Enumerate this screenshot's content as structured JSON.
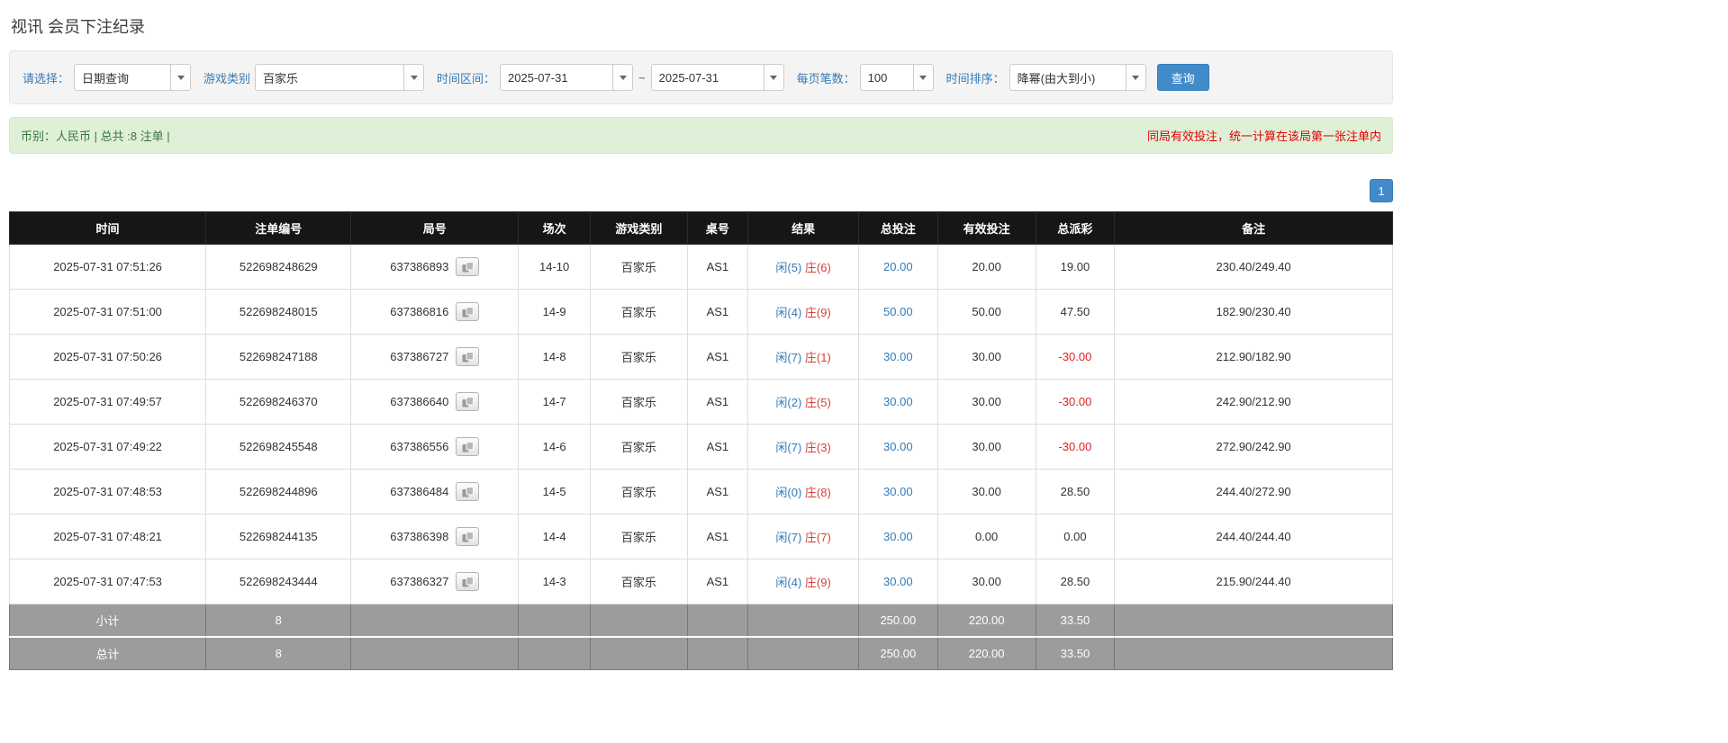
{
  "page": {
    "title": "视讯 会员下注纪录"
  },
  "filters": {
    "select_label": "请选择：",
    "select_value": "日期查询",
    "game_type_label": "游戏类别",
    "game_type_value": "百家乐",
    "time_range_label": "时间区间：",
    "time_from": "2025-07-31",
    "time_separator": "~",
    "time_to": "2025-07-31",
    "page_size_label": "每页笔数：",
    "page_size_value": "100",
    "sort_label": "时间排序：",
    "sort_value": "降幂(由大到小)",
    "search_button": "查询"
  },
  "summary": {
    "left": "币别：人民币 | 总共 :8 注单 |",
    "right": "同局有效投注，统一计算在该局第一张注单内"
  },
  "pagination": {
    "current": "1"
  },
  "table": {
    "headers": [
      "时间",
      "注单编号",
      "局号",
      "场次",
      "游戏类别",
      "桌号",
      "结果",
      "总投注",
      "有效投注",
      "总派彩",
      "备注"
    ],
    "rows": [
      {
        "time": "2025-07-31 07:51:26",
        "bet_id": "522698248629",
        "round_id": "637386893",
        "session": "14-10",
        "game": "百家乐",
        "table_no": "AS1",
        "result_player": "闲(5)",
        "result_banker": "庄(6)",
        "total_bet": "20.00",
        "valid_bet": "20.00",
        "payout": "19.00",
        "remark": "230.40/249.40"
      },
      {
        "time": "2025-07-31 07:51:00",
        "bet_id": "522698248015",
        "round_id": "637386816",
        "session": "14-9",
        "game": "百家乐",
        "table_no": "AS1",
        "result_player": "闲(4)",
        "result_banker": "庄(9)",
        "total_bet": "50.00",
        "valid_bet": "50.00",
        "payout": "47.50",
        "remark": "182.90/230.40"
      },
      {
        "time": "2025-07-31 07:50:26",
        "bet_id": "522698247188",
        "round_id": "637386727",
        "session": "14-8",
        "game": "百家乐",
        "table_no": "AS1",
        "result_player": "闲(7)",
        "result_banker": "庄(1)",
        "total_bet": "30.00",
        "valid_bet": "30.00",
        "payout": "-30.00",
        "remark": "212.90/182.90"
      },
      {
        "time": "2025-07-31 07:49:57",
        "bet_id": "522698246370",
        "round_id": "637386640",
        "session": "14-7",
        "game": "百家乐",
        "table_no": "AS1",
        "result_player": "闲(2)",
        "result_banker": "庄(5)",
        "total_bet": "30.00",
        "valid_bet": "30.00",
        "payout": "-30.00",
        "remark": "242.90/212.90"
      },
      {
        "time": "2025-07-31 07:49:22",
        "bet_id": "522698245548",
        "round_id": "637386556",
        "session": "14-6",
        "game": "百家乐",
        "table_no": "AS1",
        "result_player": "闲(7)",
        "result_banker": "庄(3)",
        "total_bet": "30.00",
        "valid_bet": "30.00",
        "payout": "-30.00",
        "remark": "272.90/242.90"
      },
      {
        "time": "2025-07-31 07:48:53",
        "bet_id": "522698244896",
        "round_id": "637386484",
        "session": "14-5",
        "game": "百家乐",
        "table_no": "AS1",
        "result_player": "闲(0)",
        "result_banker": "庄(8)",
        "total_bet": "30.00",
        "valid_bet": "30.00",
        "payout": "28.50",
        "remark": "244.40/272.90"
      },
      {
        "time": "2025-07-31 07:48:21",
        "bet_id": "522698244135",
        "round_id": "637386398",
        "session": "14-4",
        "game": "百家乐",
        "table_no": "AS1",
        "result_player": "闲(7)",
        "result_banker": "庄(7)",
        "total_bet": "30.00",
        "valid_bet": "0.00",
        "payout": "0.00",
        "remark": "244.40/244.40"
      },
      {
        "time": "2025-07-31 07:47:53",
        "bet_id": "522698243444",
        "round_id": "637386327",
        "session": "14-3",
        "game": "百家乐",
        "table_no": "AS1",
        "result_player": "闲(4)",
        "result_banker": "庄(9)",
        "total_bet": "30.00",
        "valid_bet": "30.00",
        "payout": "28.50",
        "remark": "215.90/244.40"
      }
    ],
    "subtotal": {
      "label": "小计",
      "count": "8",
      "total_bet": "250.00",
      "valid_bet": "220.00",
      "payout": "33.50"
    },
    "total": {
      "label": "总计",
      "count": "8",
      "total_bet": "250.00",
      "valid_bet": "220.00",
      "payout": "33.50"
    }
  },
  "colors": {
    "accent": "#428bca",
    "link": "#337ab7",
    "player_blue": "#337ab7",
    "banker_red": "#d43f3a",
    "negative_red": "#dd2222",
    "note_red": "#e60000",
    "header_bg": "#161616",
    "footer_bg": "#9c9c9c",
    "summary_bg": "#dff0d8",
    "summary_text": "#3c763d"
  }
}
